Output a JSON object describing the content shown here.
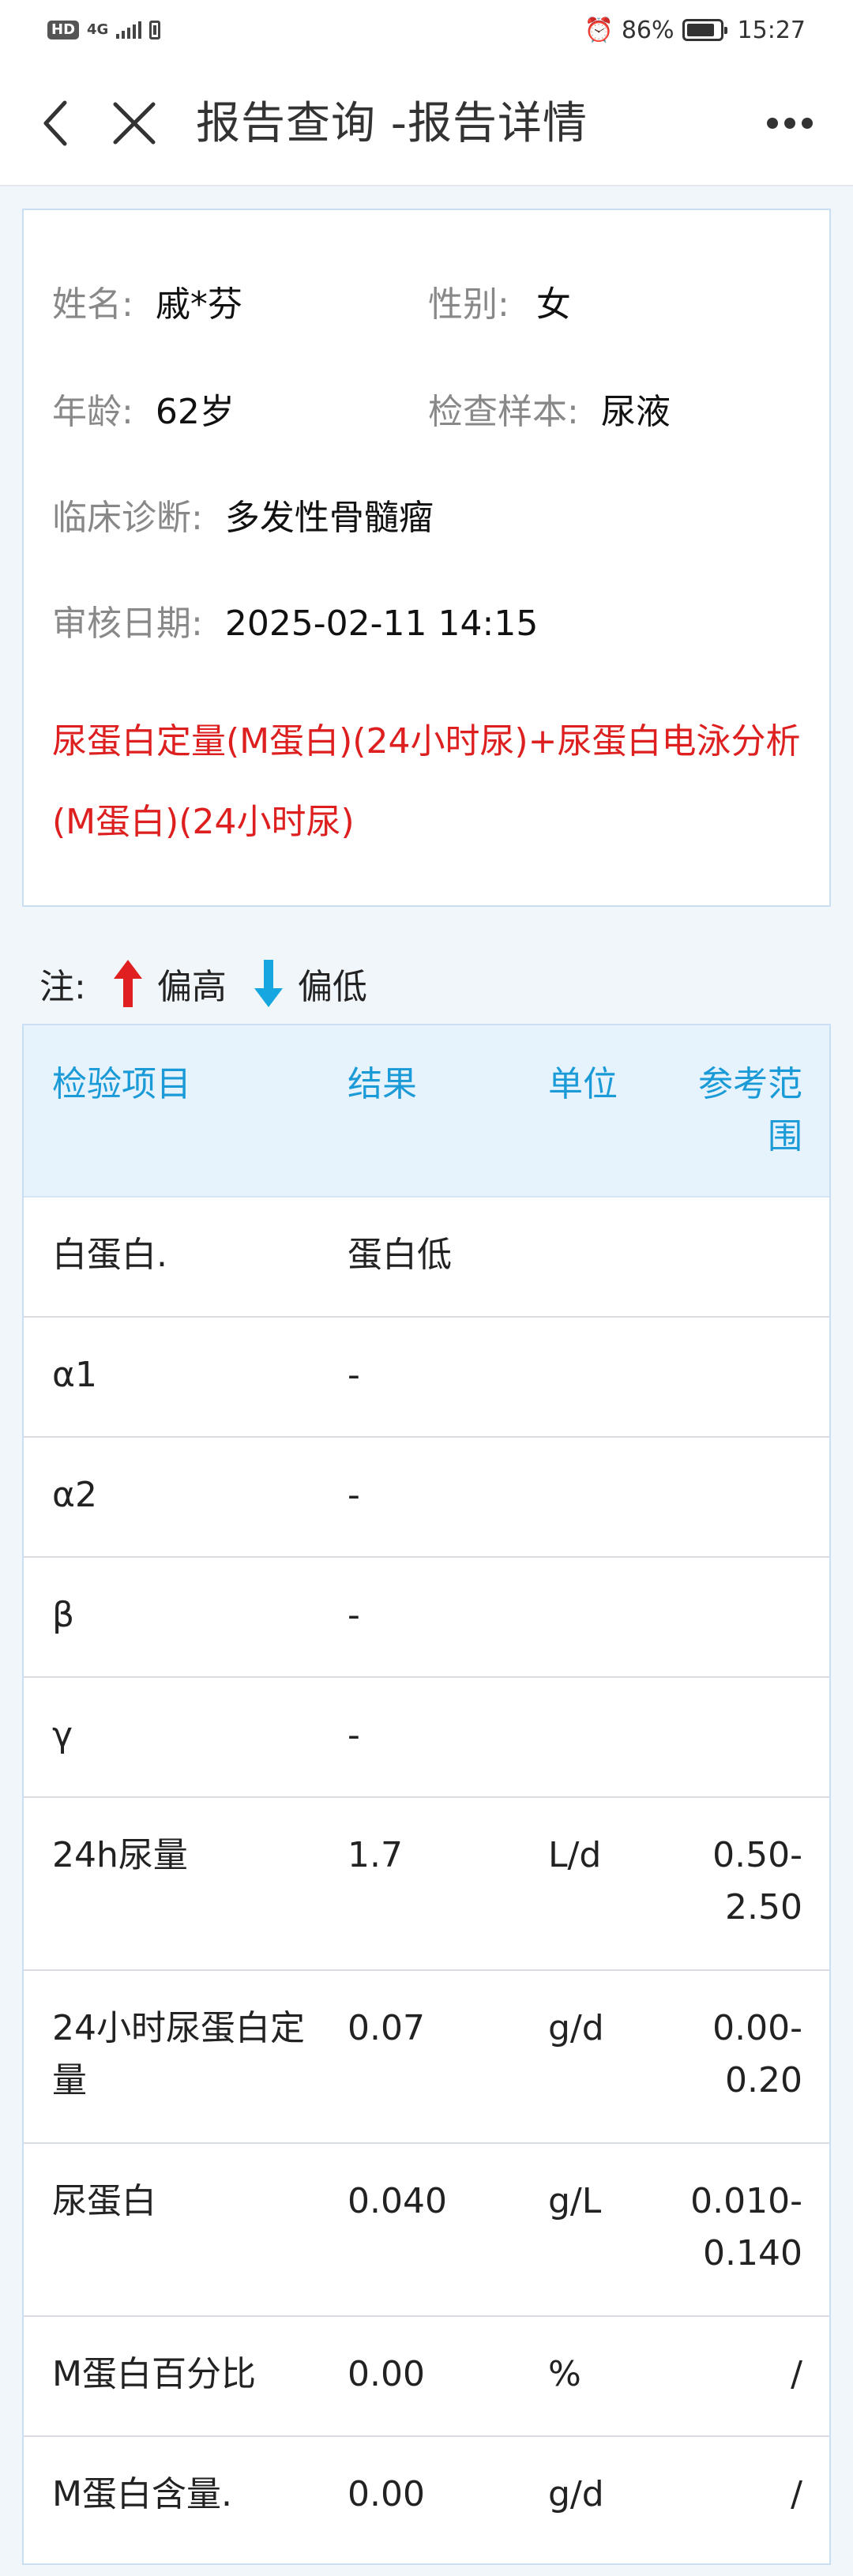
{
  "status_bar": {
    "hd": "HD",
    "network": "4G",
    "battery_percent": "86%",
    "time": "15:27"
  },
  "nav": {
    "title": "报告查询 -报告详情"
  },
  "patient": {
    "name_label": "姓名:",
    "name": "戚*芬",
    "gender_label": "性别:",
    "gender": "女",
    "age_label": "年龄:",
    "age": "62岁",
    "sample_label": "检查样本:",
    "sample": "尿液",
    "diagnosis_label": "临床诊断:",
    "diagnosis": "多发性骨髓瘤",
    "review_date_label": "审核日期:",
    "review_date": "2025-02-11 14:15",
    "test_name": "尿蛋白定量(M蛋白)(24小时尿)+尿蛋白电泳分析(M蛋白)(24小时尿)"
  },
  "legend": {
    "note": "注:",
    "high": "偏高",
    "low": "偏低",
    "high_color": "#e02020",
    "low_color": "#16a6e0"
  },
  "table": {
    "headers": {
      "item": "检验项目",
      "result": "结果",
      "unit": "单位",
      "reference": "参考范围"
    },
    "rows": [
      {
        "item": "白蛋白.",
        "result": "蛋白低",
        "unit": "",
        "reference": ""
      },
      {
        "item": "α1",
        "result": "-",
        "unit": "",
        "reference": ""
      },
      {
        "item": "α2",
        "result": "-",
        "unit": "",
        "reference": ""
      },
      {
        "item": "β",
        "result": "-",
        "unit": "",
        "reference": ""
      },
      {
        "item": "γ",
        "result": "-",
        "unit": "",
        "reference": ""
      },
      {
        "item": "24h尿量",
        "result": "1.7",
        "unit": "L/d",
        "reference": "0.50-2.50"
      },
      {
        "item": "24小时尿蛋白定量",
        "result": "0.07",
        "unit": "g/d",
        "reference": "0.00-0.20"
      },
      {
        "item": "尿蛋白",
        "result": "0.040",
        "unit": "g/L",
        "reference": "0.010-0.140"
      },
      {
        "item": "M蛋白百分比",
        "result": "0.00",
        "unit": "%",
        "reference": "/"
      },
      {
        "item": "M蛋白含量.",
        "result": "0.00",
        "unit": "g/d",
        "reference": "/"
      }
    ]
  }
}
